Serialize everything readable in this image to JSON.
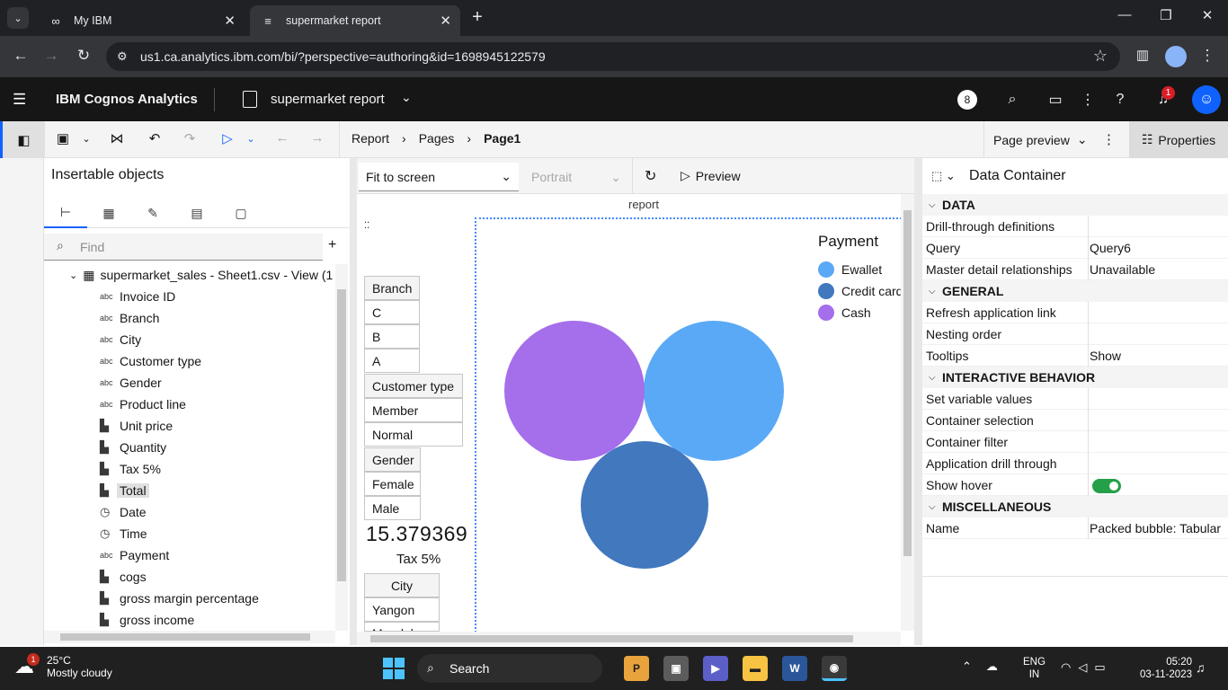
{
  "browser": {
    "tabs": [
      {
        "title": "My IBM"
      },
      {
        "title": "supermarket report"
      }
    ],
    "url": "us1.ca.analytics.ibm.com/bi/?perspective=authoring&id=1698945122579"
  },
  "app": {
    "product": "IBM Cognos Analytics",
    "report_name": "supermarket report",
    "header_badge": "8",
    "notification_count": "1"
  },
  "toolbar": {
    "breadcrumb": [
      "Report",
      "Pages",
      "Page1"
    ],
    "page_preview": "Page preview",
    "properties": "Properties"
  },
  "insertable": {
    "title": "Insertable objects",
    "find_placeholder": "Find",
    "source": "supermarket_sales - Sheet1.csv - View (1",
    "items": [
      {
        "type": "abc",
        "label": "Invoice ID"
      },
      {
        "type": "abc",
        "label": "Branch"
      },
      {
        "type": "abc",
        "label": "City"
      },
      {
        "type": "abc",
        "label": "Customer type"
      },
      {
        "type": "abc",
        "label": "Gender"
      },
      {
        "type": "abc",
        "label": "Product line"
      },
      {
        "type": "measure",
        "label": "Unit price"
      },
      {
        "type": "measure",
        "label": "Quantity"
      },
      {
        "type": "measure",
        "label": "Tax 5%"
      },
      {
        "type": "measure",
        "label": "Total"
      },
      {
        "type": "date",
        "label": "Date"
      },
      {
        "type": "time",
        "label": "Time"
      },
      {
        "type": "abc",
        "label": "Payment"
      },
      {
        "type": "measure",
        "label": "cogs"
      },
      {
        "type": "measure",
        "label": "gross margin percentage"
      },
      {
        "type": "measure",
        "label": "gross income"
      }
    ]
  },
  "canvas": {
    "fit": "Fit to screen",
    "orientation": "Portrait",
    "preview": "Preview",
    "report_label": "report",
    "branch": {
      "header": "Branch",
      "rows": [
        "C",
        "B",
        "A"
      ]
    },
    "customer_type": {
      "header": "Customer type",
      "rows": [
        "Member",
        "Normal"
      ]
    },
    "gender": {
      "header": "Gender",
      "rows": [
        "Female",
        "Male"
      ]
    },
    "kpi": {
      "value": "15.379369",
      "label": "Tax 5%"
    },
    "city": {
      "header": "City",
      "rows": [
        "Yangon",
        "Mandalay"
      ]
    }
  },
  "chart_data": {
    "type": "packed-bubble",
    "legend_title": "Payment",
    "legend_position": "top-right",
    "series": [
      {
        "name": "Ewallet",
        "color": "#5aa9f6"
      },
      {
        "name": "Credit card",
        "color": "#4178be"
      },
      {
        "name": "Cash",
        "color": "#a56eeb"
      }
    ]
  },
  "properties": {
    "object": "Data Container",
    "sections": [
      {
        "title": "DATA",
        "rows": [
          {
            "key": "Drill-through definitions",
            "value": ""
          },
          {
            "key": "Query",
            "value": "Query6"
          },
          {
            "key": "Master detail relationships",
            "value": "Unavailable"
          }
        ]
      },
      {
        "title": "GENERAL",
        "rows": [
          {
            "key": "Refresh application link",
            "value": ""
          },
          {
            "key": "Nesting order",
            "value": ""
          },
          {
            "key": "Tooltips",
            "value": "Show"
          }
        ]
      },
      {
        "title": "INTERACTIVE BEHAVIOR",
        "rows": [
          {
            "key": "Set variable values",
            "value": ""
          },
          {
            "key": "Container selection",
            "value": ""
          },
          {
            "key": "Container filter",
            "value": ""
          },
          {
            "key": "Application drill through",
            "value": ""
          },
          {
            "key": "Show hover",
            "value": "on"
          }
        ]
      },
      {
        "title": "MISCELLANEOUS",
        "rows": [
          {
            "key": "Name",
            "value": "Packed bubble: Tabular"
          }
        ]
      }
    ]
  },
  "taskbar": {
    "weather_temp": "25°C",
    "weather_desc": "Mostly cloudy",
    "weather_badge": "1",
    "search": "Search",
    "lang1": "ENG",
    "lang2": "IN",
    "time": "05:20",
    "date": "03-11-2023"
  },
  "colors": {
    "accent": "#0f62fe",
    "toggle_on": "#24a148"
  }
}
